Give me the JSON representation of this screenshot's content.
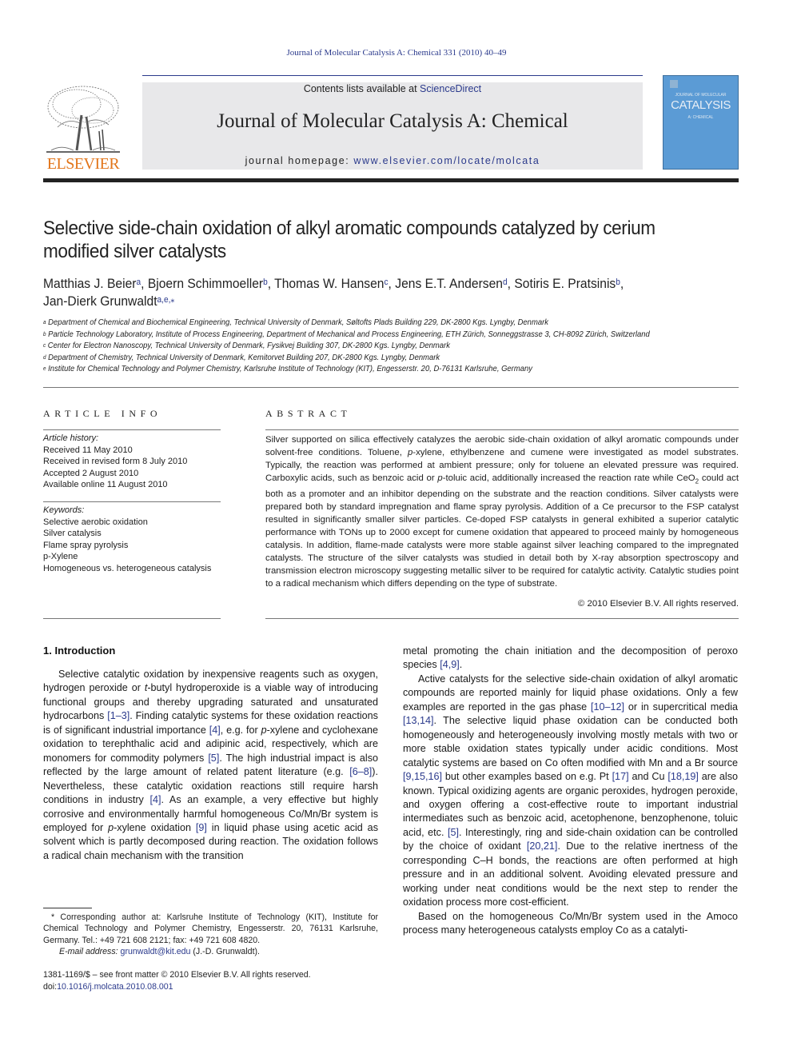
{
  "running_head": "Journal of Molecular Catalysis A: Chemical 331 (2010) 40–49",
  "masthead": {
    "publisher": "ELSEVIER",
    "contents_prefix": "Contents lists available at ",
    "contents_link": "ScienceDirect",
    "journal_title": "Journal of Molecular Catalysis A: Chemical",
    "homepage_prefix": "journal homepage: ",
    "homepage_link": "www.elsevier.com/locate/molcata",
    "cover_small": "JOURNAL OF MOLECULAR",
    "cover_big": "CATALYSIS",
    "cover_sub": "A: CHEMICAL"
  },
  "article": {
    "title": "Selective side-chain oxidation of alkyl aromatic compounds catalyzed by cerium modified silver catalysts",
    "authors": [
      {
        "name": "Matthias J. Beier",
        "sup": "a",
        "sep": ", "
      },
      {
        "name": "Bjoern Schimmoeller",
        "sup": "b",
        "sep": ", "
      },
      {
        "name": "Thomas W. Hansen",
        "sup": "c",
        "sep": ", "
      },
      {
        "name": "Jens E.T. Andersen",
        "sup": "d",
        "sep": ", "
      },
      {
        "name": "Sotiris E. Pratsinis",
        "sup": "b",
        "sep": ","
      },
      {
        "name": "Jan-Dierk Grunwaldt",
        "sup": "a,e,⁎",
        "sep": ""
      }
    ],
    "affiliations": [
      {
        "key": "a",
        "text": "Department of Chemical and Biochemical Engineering, Technical University of Denmark, Søltofts Plads Building 229, DK-2800 Kgs. Lyngby, Denmark"
      },
      {
        "key": "b",
        "text": "Particle Technology Laboratory, Institute of Process Engineering, Department of Mechanical and Process Engineering, ETH Zürich, Sonneggstrasse 3, CH-8092 Zürich, Switzerland"
      },
      {
        "key": "c",
        "text": "Center for Electron Nanoscopy, Technical University of Denmark, Fysikvej Building 307, DK-2800 Kgs. Lyngby, Denmark"
      },
      {
        "key": "d",
        "text": "Department of Chemistry, Technical University of Denmark, Kemitorvet Building 207, DK-2800 Kgs. Lyngby, Denmark"
      },
      {
        "key": "e",
        "text": "Institute for Chemical Technology and Polymer Chemistry, Karlsruhe Institute of Technology (KIT), Engesserstr. 20, D-76131 Karlsruhe, Germany"
      }
    ]
  },
  "article_info": {
    "heading": "ARTICLE INFO",
    "history_label": "Article history:",
    "history": [
      "Received 11 May 2010",
      "Received in revised form 8 July 2010",
      "Accepted 2 August 2010",
      "Available online 11 August 2010"
    ],
    "keywords_label": "Keywords:",
    "keywords": [
      "Selective aerobic oxidation",
      "Silver catalysis",
      "Flame spray pyrolysis",
      "p-Xylene",
      "Homogeneous vs. heterogeneous catalysis"
    ]
  },
  "abstract": {
    "heading": "ABSTRACT",
    "text_1": "Silver supported on silica effectively catalyzes the aerobic side-chain oxidation of alkyl aromatic compounds under solvent-free conditions. Toluene, ",
    "italic_p1": "p",
    "text_2": "-xylene, ethylbenzene and cumene were investigated as model substrates. Typically, the reaction was performed at ambient pressure; only for toluene an elevated pressure was required. Carboxylic acids, such as benzoic acid or ",
    "italic_p2": "p",
    "text_3": "-toluic acid, additionally increased the reaction rate while CeO",
    "sub_2": "2",
    "text_4": " could act both as a promoter and an inhibitor depending on the substrate and the reaction conditions. Silver catalysts were prepared both by standard impregnation and flame spray pyrolysis. Addition of a Ce precursor to the FSP catalyst resulted in significantly smaller silver particles. Ce-doped FSP catalysts in general exhibited a superior catalytic performance with TONs up to 2000 except for cumene oxidation that appeared to proceed mainly by homogeneous catalysis. In addition, flame-made catalysts were more stable against silver leaching compared to the impregnated catalysts. The structure of the silver catalysts was studied in detail both by X-ray absorption spectroscopy and transmission electron microscopy suggesting metallic silver to be required for catalytic activity. Catalytic studies point to a radical mechanism which differs depending on the type of substrate.",
    "copyright": "© 2010 Elsevier B.V. All rights reserved."
  },
  "body": {
    "section_heading": "1.  Introduction",
    "left_p1": [
      {
        "t": "Selective catalytic oxidation by inexpensive reagents such as oxygen, hydrogen peroxide or "
      },
      {
        "i": "t"
      },
      {
        "t": "-butyl hydroperoxide is a viable way of introducing functional groups and thereby upgrading saturated and unsaturated hydrocarbons "
      },
      {
        "r": "[1–3]"
      },
      {
        "t": ". Finding catalytic systems for these oxidation reactions is of significant industrial importance "
      },
      {
        "r": "[4]"
      },
      {
        "t": ", e.g. for "
      },
      {
        "i": "p"
      },
      {
        "t": "-xylene and cyclohexane oxidation to terephthalic acid and adipinic acid, respectively, which are monomers for commodity polymers "
      },
      {
        "r": "[5]"
      },
      {
        "t": ". The high industrial impact is also reflected by the large amount of related patent literature (e.g. "
      },
      {
        "r": "[6–8]"
      },
      {
        "t": "). Nevertheless, these catalytic oxidation reactions still require harsh conditions in industry "
      },
      {
        "r": "[4]"
      },
      {
        "t": ". As an example, a very effective but highly corrosive and environmentally harmful homogeneous Co/Mn/Br system is employed for "
      },
      {
        "i": "p"
      },
      {
        "t": "-xylene oxidation "
      },
      {
        "r": "[9]"
      },
      {
        "t": " in liquid phase using acetic acid as solvent which is partly decomposed during reaction. The oxidation follows a radical chain mechanism with the transition"
      }
    ],
    "right_p0": [
      {
        "t": "metal promoting the chain initiation and the decomposition of peroxo species "
      },
      {
        "r": "[4,9]"
      },
      {
        "t": "."
      }
    ],
    "right_p1": [
      {
        "t": "Active catalysts for the selective side-chain oxidation of alkyl aromatic compounds are reported mainly for liquid phase oxidations. Only a few examples are reported in the gas phase "
      },
      {
        "r": "[10–12]"
      },
      {
        "t": " or in supercritical media "
      },
      {
        "r": "[13,14]"
      },
      {
        "t": ". The selective liquid phase oxidation can be conducted both homogeneously and heterogeneously involving mostly metals with two or more stable oxidation states typically under acidic conditions. Most catalytic systems are based on Co often modified with Mn and a Br source "
      },
      {
        "r": "[9,15,16]"
      },
      {
        "t": " but other examples based on e.g. Pt "
      },
      {
        "r": "[17]"
      },
      {
        "t": " and Cu "
      },
      {
        "r": "[18,19]"
      },
      {
        "t": " are also known. Typical oxidizing agents are organic peroxides, hydrogen peroxide, and oxygen offering a cost-effective route to important industrial intermediates such as benzoic acid, acetophenone, benzophenone, toluic acid, etc. "
      },
      {
        "r": "[5]"
      },
      {
        "t": ". Interestingly, ring and side-chain oxidation can be controlled by the choice of oxidant "
      },
      {
        "r": "[20,21]"
      },
      {
        "t": ". Due to the relative inertness of the corresponding C–H bonds, the reactions are often performed at high pressure and in an additional solvent. Avoiding elevated pressure and working under neat conditions would be the next step to render the oxidation process more cost-efficient."
      }
    ],
    "right_p2": [
      {
        "t": "Based on the homogeneous Co/Mn/Br system used in the Amoco process many heterogeneous catalysts employ Co as a catalyti-"
      }
    ]
  },
  "footnote": {
    "corresponding": "* Corresponding author at: Karlsruhe Institute of Technology (KIT), Institute for Chemical Technology and Polymer Chemistry, Engesserstr. 20, 76131 Karlsruhe, Germany. Tel.: +49 721 608 2121; fax: +49 721 608 4820.",
    "email_label": "E-mail address: ",
    "email": "grunwaldt@kit.edu",
    "email_suffix": " (J.-D. Grunwaldt)."
  },
  "issn": {
    "line1": "1381-1169/$ – see front matter © 2010 Elsevier B.V. All rights reserved.",
    "doi_prefix": "doi:",
    "doi": "10.1016/j.molcata.2010.08.001"
  },
  "colors": {
    "link": "#2b3a8c",
    "elsevier_orange": "#e2751a",
    "masthead_bg": "#e8e8ea",
    "cover_blue": "#5b9bd5"
  }
}
